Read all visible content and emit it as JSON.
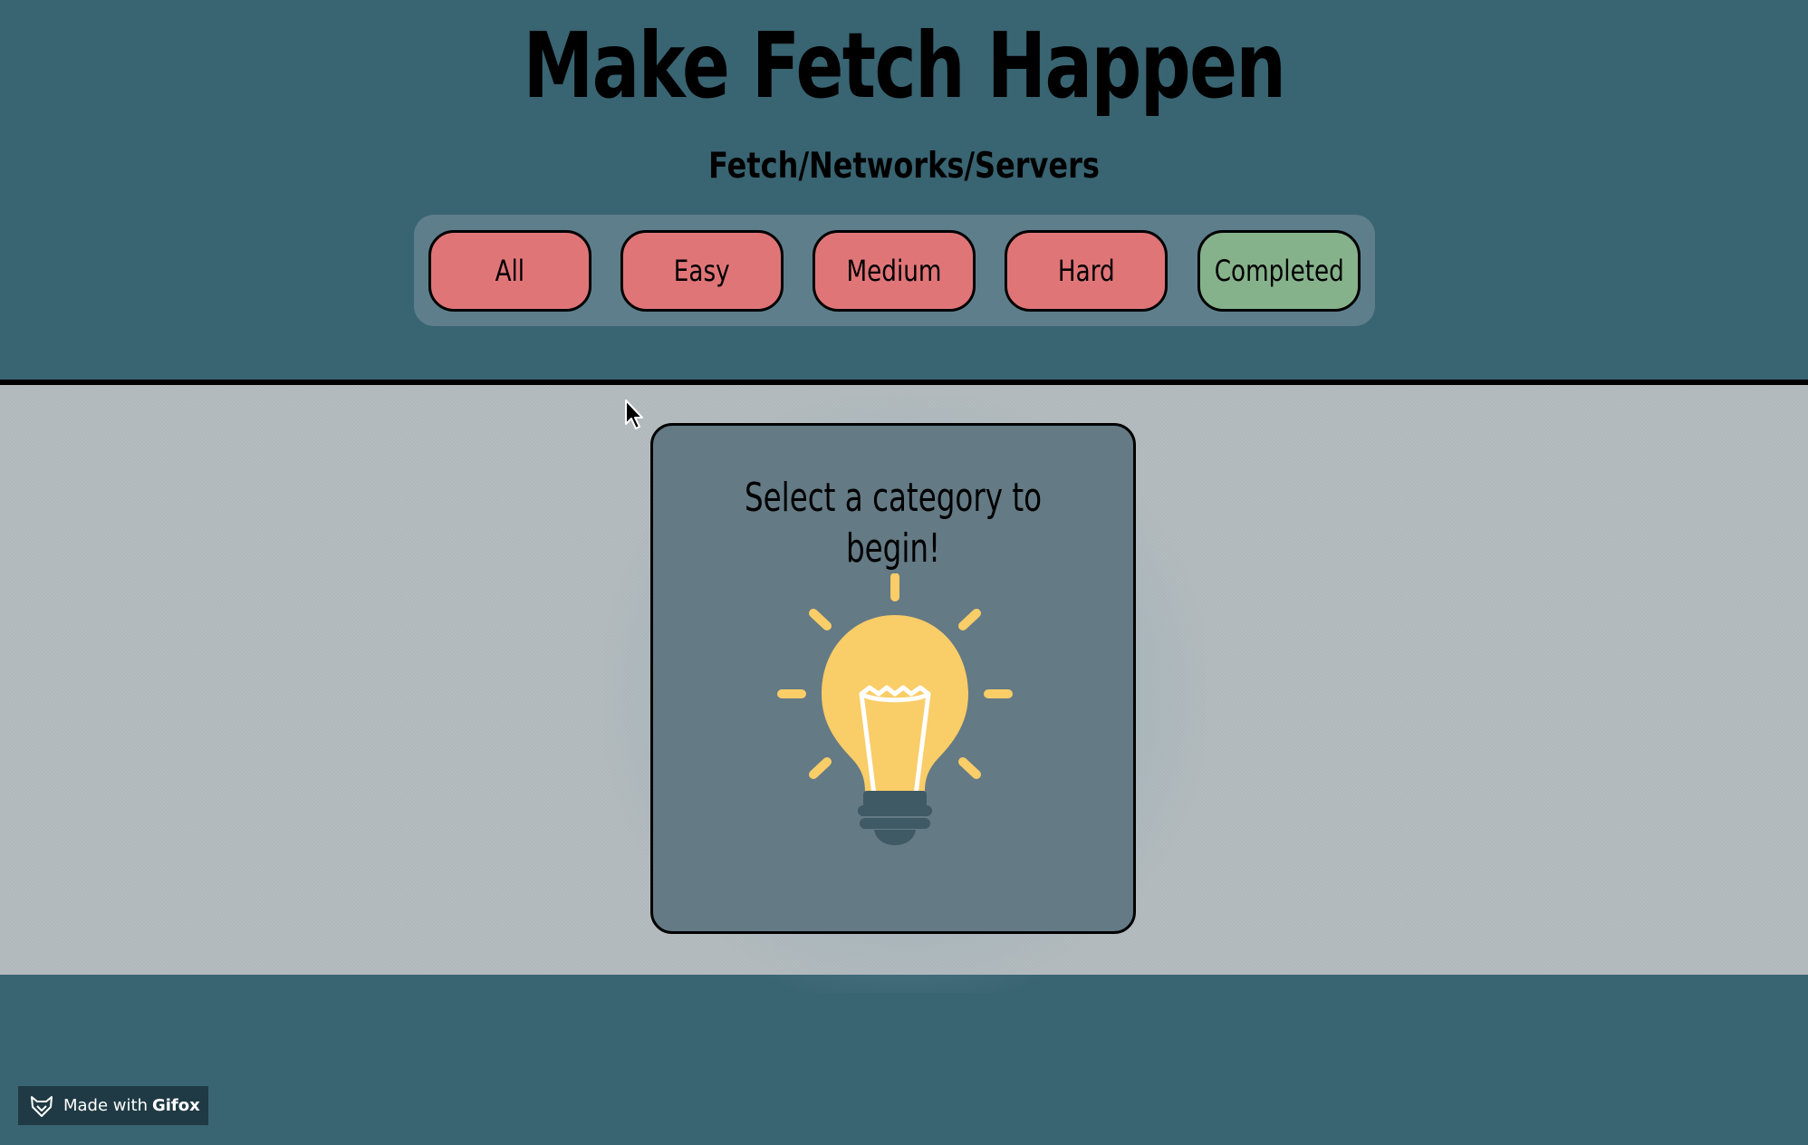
{
  "header": {
    "title": "Make Fetch Happen",
    "subtitle": "Fetch/Networks/Servers"
  },
  "nav": {
    "buttons": [
      {
        "label": "All",
        "color": "#e07578"
      },
      {
        "label": "Easy",
        "color": "#e07578"
      },
      {
        "label": "Medium",
        "color": "#e07578"
      },
      {
        "label": "Hard",
        "color": "#e07578"
      },
      {
        "label": "Completed",
        "color": "#86b28b"
      }
    ]
  },
  "card": {
    "message": "Select a category to begin!",
    "icon": "lightbulb-icon"
  },
  "badge": {
    "prefix": "Made with",
    "brand": "Gifox",
    "icon": "fox-icon"
  },
  "colors": {
    "background": "#396472",
    "content_area": "#b5bcbf",
    "card": "#647a85",
    "bulb": "#f9cd67"
  }
}
